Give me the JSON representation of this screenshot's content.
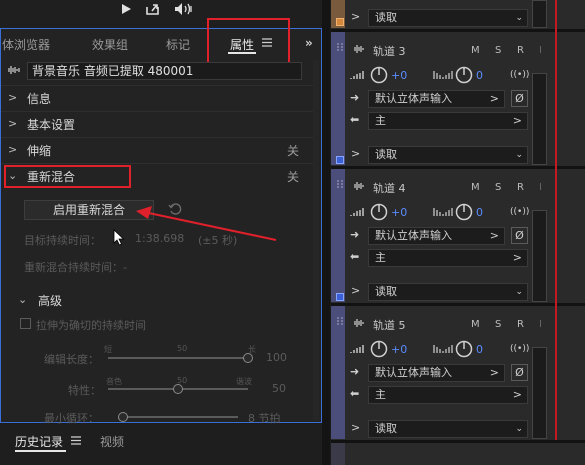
{
  "left": {
    "tabs": {
      "media_browser": "体浏览器",
      "effects_rack": "效果组",
      "markers": "标记",
      "properties": "属性"
    },
    "clip_name": "背景音乐 音频已提取 480001",
    "sections": {
      "info": "信息",
      "basic": "基本设置",
      "stretch": "伸缩",
      "stretch_state": "关",
      "remix": "重新混合",
      "remix_state": "关"
    },
    "remix": {
      "enable_button": "启用重新混合",
      "target_duration_label": "目标持续时间：",
      "target_duration_value": "1:38.698",
      "tolerance": "(±5 秒)",
      "remix_duration_label": "重新混合持续时间：-",
      "advanced": "高级",
      "stretch_option": "拉伸为确切的持续时间",
      "edit_length_label": "编辑长度：",
      "edit_short": "短",
      "edit_mid": "50",
      "edit_long": "长",
      "edit_value": "100",
      "features_label": "特性：",
      "features_tone": "音色",
      "features_mid": "50",
      "features_harmony": "谐波",
      "features_value": "50",
      "min_loop_label": "最小循环：",
      "min_loop_value": "8 节拍"
    },
    "bottom_tabs": {
      "history": "历史记录",
      "video": "视频"
    }
  },
  "mixer": {
    "top_read": "读取",
    "tracks": [
      {
        "name": "轨道 3",
        "m": "M",
        "s": "S",
        "r": "R",
        "i": "I",
        "volume": "+0",
        "pan": "0",
        "input": "默认立体声输入",
        "output": "主",
        "automation": "读取"
      },
      {
        "name": "轨道 4",
        "m": "M",
        "s": "S",
        "r": "R",
        "i": "I",
        "volume": "+0",
        "pan": "0",
        "input": "默认立体声输入",
        "output": "主",
        "automation": "读取"
      },
      {
        "name": "轨道 5",
        "m": "M",
        "s": "S",
        "r": "R",
        "i": "I",
        "volume": "+0",
        "pan": "0",
        "input": "默认立体声输入",
        "output": "主",
        "automation": "读取"
      }
    ]
  },
  "colors": {
    "accent_blue": "#5a8cff",
    "highlight_red": "#e0202a",
    "panel_border": "#3a6fd8"
  }
}
